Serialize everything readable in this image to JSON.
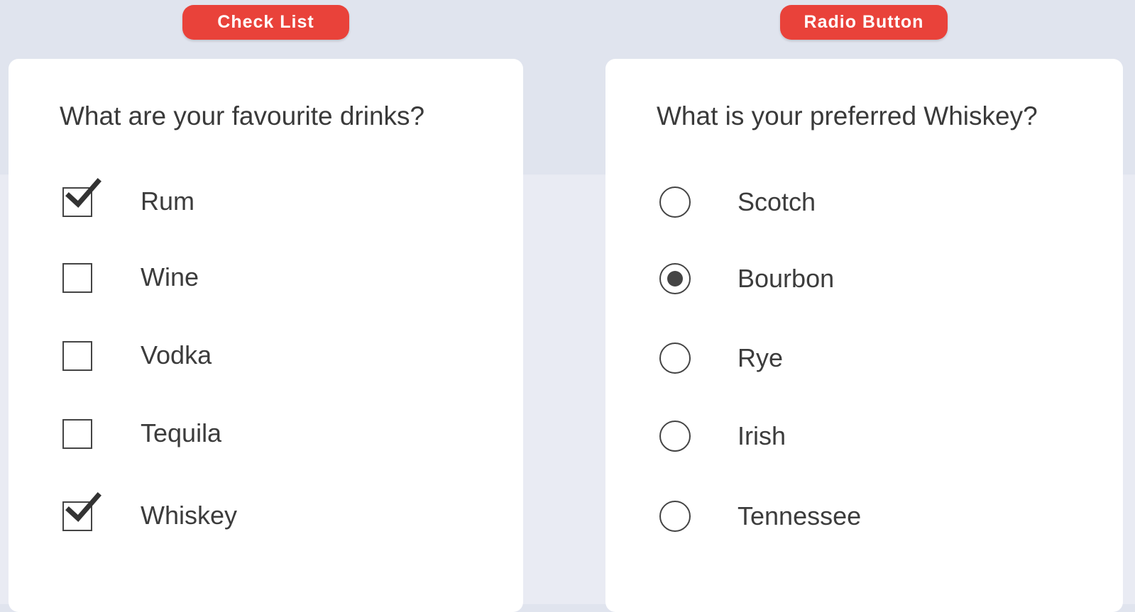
{
  "checklist": {
    "badge": "Check List",
    "question": "What are your favourite drinks?",
    "options": [
      {
        "label": "Rum",
        "checked": true
      },
      {
        "label": "Wine",
        "checked": false
      },
      {
        "label": "Vodka",
        "checked": false
      },
      {
        "label": "Tequila",
        "checked": false
      },
      {
        "label": "Whiskey",
        "checked": true
      }
    ]
  },
  "radio": {
    "badge": "Radio Button",
    "question": "What is your preferred Whiskey?",
    "options": [
      {
        "label": "Scotch",
        "selected": false
      },
      {
        "label": "Bourbon",
        "selected": true
      },
      {
        "label": "Rye",
        "selected": false
      },
      {
        "label": "Irish",
        "selected": false
      },
      {
        "label": "Tennessee",
        "selected": false
      }
    ]
  },
  "colors": {
    "badge": "#e9423a",
    "control": "#444444",
    "text": "#3c3c3c"
  },
  "icons": {
    "checked": "checkmark-icon"
  }
}
